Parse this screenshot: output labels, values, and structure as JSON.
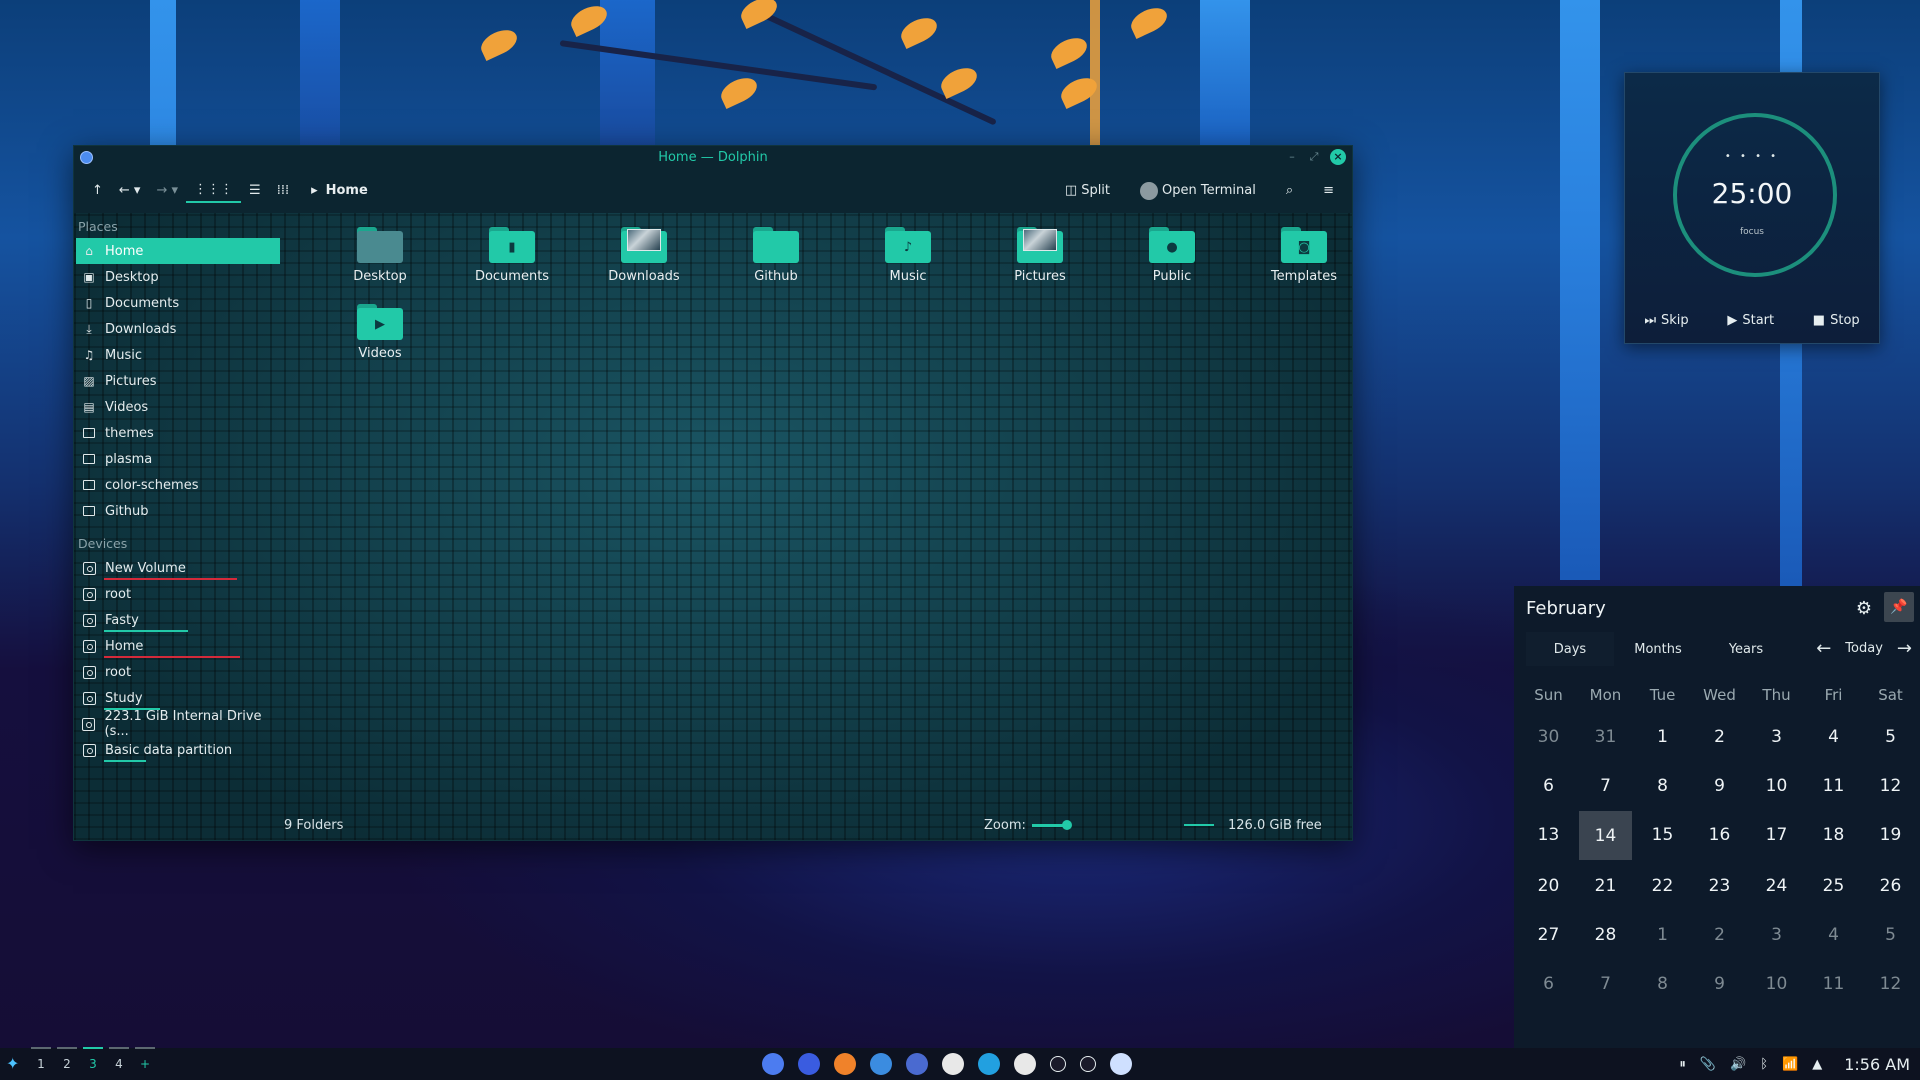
{
  "window": {
    "title": "Home — Dolphin",
    "toolbar": {
      "breadcrumb": "Home",
      "split_label": "Split",
      "terminal_label": "Open Terminal"
    },
    "places_heading": "Places",
    "places": [
      {
        "label": "Home",
        "icon": "home-icon",
        "selected": true
      },
      {
        "label": "Desktop",
        "icon": "desktop-icon"
      },
      {
        "label": "Documents",
        "icon": "document-icon"
      },
      {
        "label": "Downloads",
        "icon": "download-icon"
      },
      {
        "label": "Music",
        "icon": "music-icon"
      },
      {
        "label": "Pictures",
        "icon": "picture-icon"
      },
      {
        "label": "Videos",
        "icon": "video-icon"
      },
      {
        "label": "themes",
        "icon": "folder-icon"
      },
      {
        "label": "plasma",
        "icon": "folder-icon"
      },
      {
        "label": "color-schemes",
        "icon": "folder-icon"
      },
      {
        "label": "Github",
        "icon": "folder-icon"
      }
    ],
    "devices_heading": "Devices",
    "devices": [
      {
        "label": "New Volume",
        "usage_color": "#d42a3a",
        "usage": 0.95
      },
      {
        "label": "root",
        "usage_color": "",
        "usage": 0
      },
      {
        "label": "Fasty",
        "usage_color": "#22c9a8",
        "usage": 0.6
      },
      {
        "label": "Home",
        "usage_color": "#d42a3a",
        "usage": 0.97
      },
      {
        "label": "root",
        "usage_color": "",
        "usage": 0
      },
      {
        "label": "Study",
        "usage_color": "#22c9a8",
        "usage": 0.4
      },
      {
        "label": "223.1 GiB Internal Drive (s...",
        "usage_color": "",
        "usage": 0
      },
      {
        "label": "Basic data partition",
        "usage_color": "#22c9a8",
        "usage": 0.3
      }
    ],
    "folders": [
      {
        "name": "Desktop",
        "emblem": "desktop-thumb"
      },
      {
        "name": "Documents",
        "emblem": "document-emblem"
      },
      {
        "name": "Downloads",
        "emblem": "preview-thumb"
      },
      {
        "name": "Github",
        "emblem": ""
      },
      {
        "name": "Music",
        "emblem": "music-emblem"
      },
      {
        "name": "Pictures",
        "emblem": "preview-thumb"
      },
      {
        "name": "Public",
        "emblem": "person-emblem"
      },
      {
        "name": "Templates",
        "emblem": "template-emblem"
      },
      {
        "name": "Videos",
        "emblem": "video-emblem"
      }
    ],
    "status": {
      "count": "9 Folders",
      "zoom_label": "Zoom:",
      "free_space": "126.0 GiB free"
    }
  },
  "pomodoro": {
    "dots": "• • • •",
    "time": "25:00",
    "label": "focus",
    "skip": "Skip",
    "start": "Start",
    "stop": "Stop"
  },
  "calendar": {
    "month": "February",
    "tabs": [
      "Days",
      "Months",
      "Years"
    ],
    "today_label": "Today",
    "weekdays": [
      "Sun",
      "Mon",
      "Tue",
      "Wed",
      "Thu",
      "Fri",
      "Sat"
    ],
    "days": [
      [
        "30",
        "31",
        "1",
        "2",
        "3",
        "4",
        "5"
      ],
      [
        "6",
        "7",
        "8",
        "9",
        "10",
        "11",
        "12"
      ],
      [
        "13",
        "14",
        "15",
        "16",
        "17",
        "18",
        "19"
      ],
      [
        "20",
        "21",
        "22",
        "23",
        "24",
        "25",
        "26"
      ],
      [
        "27",
        "28",
        "1",
        "2",
        "3",
        "4",
        "5"
      ],
      [
        "6",
        "7",
        "8",
        "9",
        "10",
        "11",
        "12"
      ]
    ],
    "today": "14"
  },
  "taskbar": {
    "desktops": [
      "1",
      "2",
      "3",
      "4"
    ],
    "current_desktop": "3",
    "add_label": "+",
    "apps": [
      {
        "name": "blue-app-icon",
        "color": "#4c7cf0"
      },
      {
        "name": "mail-icon",
        "color": "#3a5ce0"
      },
      {
        "name": "brave-icon",
        "color": "#f0822a"
      },
      {
        "name": "dolphin-icon",
        "color": "#3b8ce0"
      },
      {
        "name": "chrome-icon",
        "color": "#4a6ad0"
      },
      {
        "name": "github-icon",
        "color": "#e8e8e8"
      },
      {
        "name": "vscode-icon",
        "color": "#22a0e0"
      },
      {
        "name": "obs-icon",
        "color": "#e8e8e8"
      },
      {
        "name": "drop-icon",
        "color": "#1a1a2a"
      },
      {
        "name": "circle-icon",
        "color": "#1a1a2a"
      },
      {
        "name": "cloud-icon",
        "color": "#cfe0ff"
      }
    ],
    "clock": "1:56 AM"
  }
}
